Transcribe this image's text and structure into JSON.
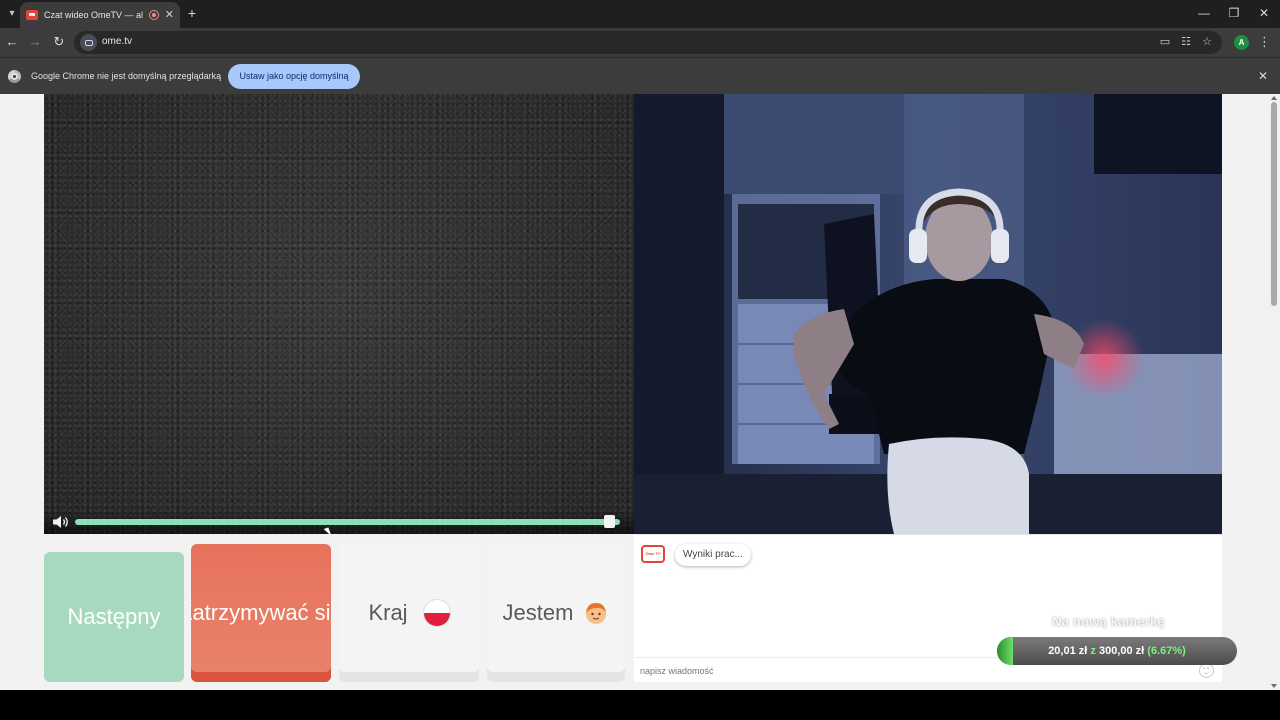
{
  "browser": {
    "tab": {
      "title": "Czat wideo OmeTV — alternatywa",
      "favicon": "ometv-tv-icon",
      "recording_icon": "recording-icon"
    },
    "url": "ome.tv",
    "profile_initial": "A",
    "infobar": {
      "message": "Google Chrome nie jest domyślną przeglądarką",
      "button_label": "Ustaw jako opcję domyślną"
    }
  },
  "page": {
    "buttons": {
      "next": "Następny",
      "stop": "Zatrzymywać się",
      "country": "Kraj",
      "gender": "Jestem"
    },
    "volume_level": 0.98,
    "chat": {
      "avatar_label": "Ome TV",
      "bubble": "Wyniki prac...",
      "input_placeholder": "napisz wiadomość"
    },
    "goal": {
      "title": "Na nową kamerkę",
      "current": "20,01 zł",
      "connector": "z",
      "target": "300,00 zł",
      "percent": "(6.67%)",
      "fraction": 0.0667
    }
  },
  "colors": {
    "next_button": "#a6d9bd",
    "stop_button": "#e7725c",
    "volume_track": "#8ce0b6",
    "infobar_button": "#a8c7fa",
    "accent_red": "#e8433b"
  }
}
